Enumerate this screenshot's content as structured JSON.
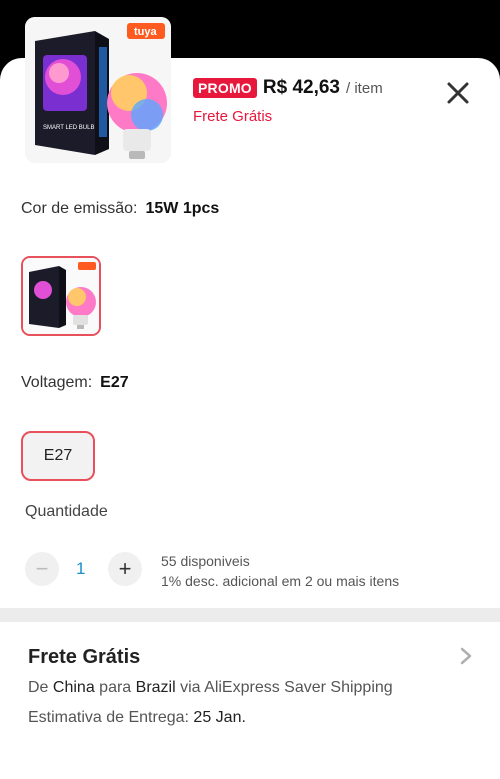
{
  "product": {
    "brand_badge": "tuya",
    "box_text": "SMART LED BULB"
  },
  "header": {
    "promo_badge": "PROMO",
    "price": "R$ 42,63",
    "per_item": "/ item",
    "shipping_note": "Frete Grátis"
  },
  "color_option": {
    "label": "Cor de emissão:",
    "value": "15W  1pcs"
  },
  "voltage_option": {
    "label": "Voltagem:",
    "value": "E27",
    "button_label": "E27"
  },
  "quantity": {
    "title": "Quantidade",
    "minus": "−",
    "plus": "+",
    "value": "1",
    "available": "55 disponiveis",
    "discount": "1% desc. adicional em 2 ou mais itens"
  },
  "shipping": {
    "title": "Frete Grátis",
    "from_word": "De",
    "from": "China",
    "to_word": "para",
    "to": "Brazil",
    "via": "via AliExpress Saver Shipping",
    "estimate_label": "Estimativa de Entrega:",
    "estimate_date": "25 Jan."
  },
  "colors": {
    "accent": "#e8173c",
    "qty_blue": "#1a8fc9"
  }
}
